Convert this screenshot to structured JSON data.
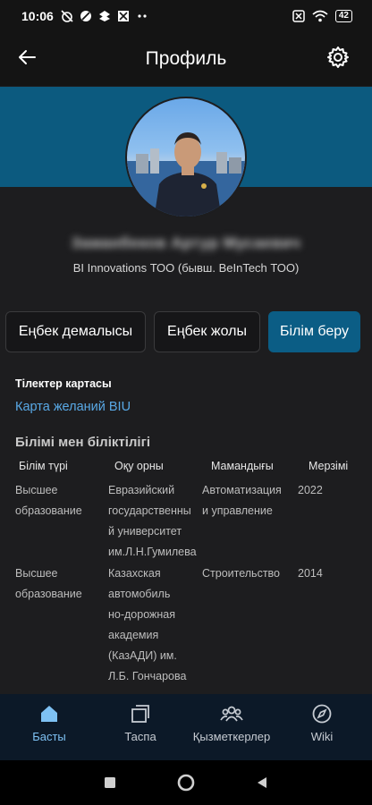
{
  "status_bar": {
    "time": "10:06",
    "battery": "42",
    "icons_left": [
      "alarm-off-icon",
      "sync-icon",
      "dropbox-icon",
      "app-icon",
      "more-dots-icon"
    ],
    "icons_right": [
      "close-box-icon",
      "wifi-icon",
      "battery-icon"
    ]
  },
  "app_bar": {
    "title": "Профиль",
    "back_icon": "arrow-left-icon",
    "settings_icon": "gear-icon"
  },
  "profile": {
    "name": "Заманбеков Артур Мусаевич",
    "company": "BI Innovations ТОО (бывш. BeInTech ТОО)"
  },
  "tabs": [
    {
      "label": "Еңбек демалысы",
      "active": false
    },
    {
      "label": "Еңбек жолы",
      "active": false
    },
    {
      "label": "Білім беру",
      "active": true
    }
  ],
  "languages": {
    "label": "Тілектер картасы",
    "link": "Карта желаний BIU"
  },
  "education": {
    "title": "Білімі мен біліктілігі",
    "columns": [
      "Білім түрі",
      "Оқу орны",
      "Мамандығы",
      "Мерзімі"
    ],
    "rows": [
      {
        "type": [
          "Высшее",
          "образование"
        ],
        "institution": [
          "Евразийский",
          "государственны",
          "й университет",
          "им.Л.Н.Гумилева"
        ],
        "specialty": [
          "Автоматизация",
          "и управление"
        ],
        "year": "2022"
      },
      {
        "type": [
          "Высшее",
          "образование"
        ],
        "institution": [
          "Казахская",
          "автомобиль",
          "но-дорожная",
          "академия",
          "(КазАДИ) им.",
          "Л.Б. Гончарова"
        ],
        "specialty": [
          "Строительство"
        ],
        "year": "2014"
      }
    ]
  },
  "bottom_nav": [
    {
      "label": "Басты",
      "icon": "home-icon",
      "active": true
    },
    {
      "label": "Таспа",
      "icon": "feed-icon",
      "active": false
    },
    {
      "label": "Қызметкерлер",
      "icon": "people-icon",
      "active": false
    },
    {
      "label": "Wiki",
      "icon": "compass-icon",
      "active": false
    }
  ],
  "colors": {
    "background": "#1d1d1f",
    "banner": "#0c5a7f",
    "active_tab": "#0b5d85",
    "link": "#59a9e6",
    "bottom_nav": "#0c1928",
    "active_nav": "#7ec1f3"
  }
}
